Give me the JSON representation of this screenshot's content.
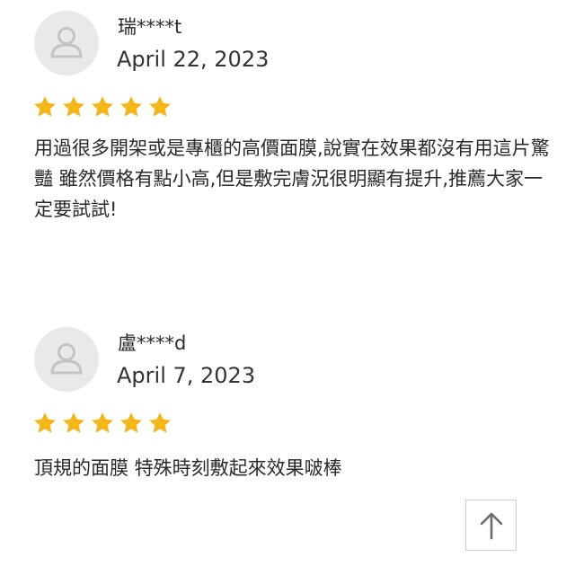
{
  "reviews": [
    {
      "reviewer": "瑞****t",
      "date": "April 22, 2023",
      "rating": 5,
      "text": "用過很多開架或是專櫃的高價面膜,說實在效果都沒有用這片驚豔 雖然價格有點小高,但是敷完膚況很明顯有提升,推薦大家一定要試試!"
    },
    {
      "reviewer": "盧****d",
      "date": "April 7, 2023",
      "rating": 5,
      "text": "頂規的面膜 特殊時刻敷起來效果啵棒"
    }
  ],
  "icons": {
    "avatar": "user-silhouette-icon",
    "star": "star-icon",
    "back_to_top": "arrow-up-icon"
  },
  "colors": {
    "star": "#f5b716",
    "avatar_bg": "#e9e9e9",
    "avatar_fg": "#c4c4c4"
  }
}
